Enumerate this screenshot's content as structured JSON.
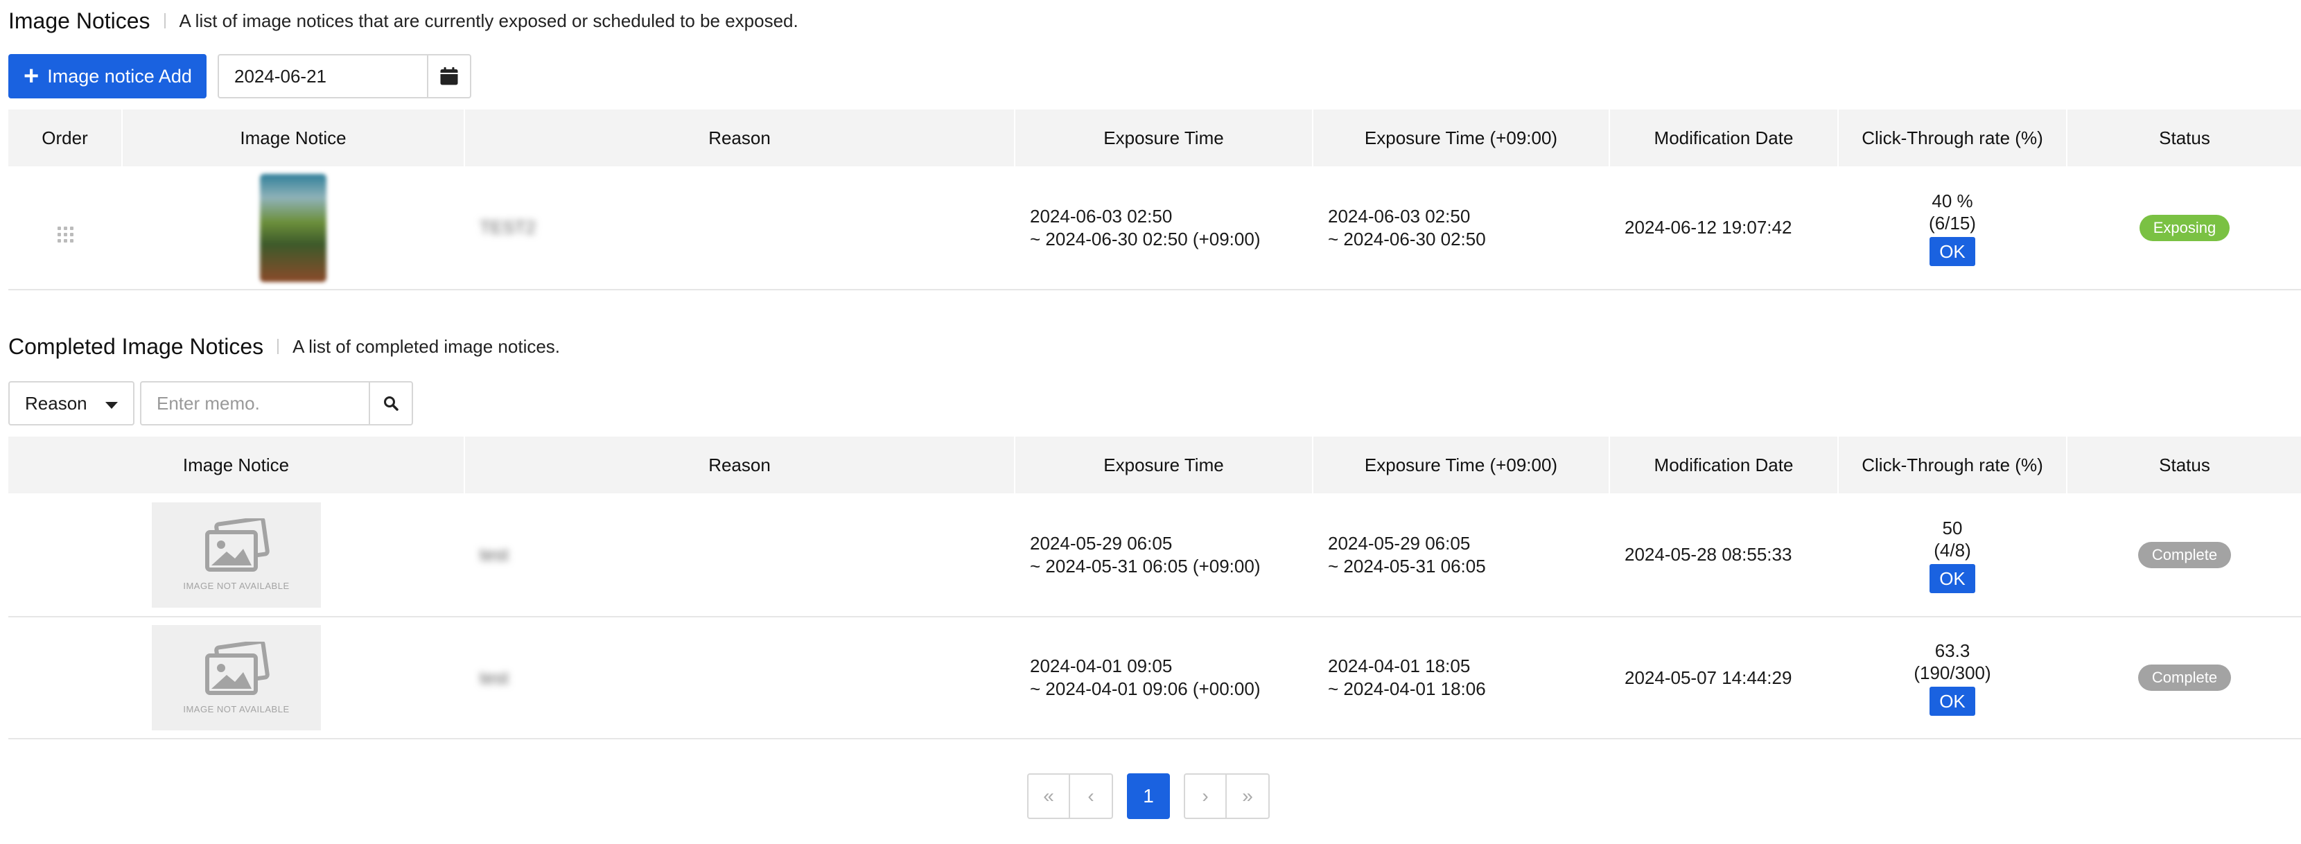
{
  "active_section": {
    "title": "Image Notices",
    "description": "A list of image notices that are currently exposed or scheduled to be exposed.",
    "add_button": "Image notice Add",
    "date_value": "2024-06-21",
    "headers": [
      "Order",
      "Image Notice",
      "Reason",
      "Exposure Time",
      "Exposure Time (+09:00)",
      "Modification Date",
      "Click-Through rate (%)",
      "Status"
    ],
    "rows": [
      {
        "reason": "TEST2",
        "exposure_start": "2024-06-03 02:50",
        "exposure_end": "~ 2024-06-30 02:50 (+09:00)",
        "kst_start": "2024-06-03 02:50",
        "kst_end": "~ 2024-06-30 02:50",
        "modified": "2024-06-12 19:07:42",
        "ctr_rate": "40 %",
        "ctr_count": "(6/15)",
        "ok_label": "OK",
        "status": "Exposing"
      }
    ]
  },
  "completed_section": {
    "title": "Completed Image Notices",
    "description": "A list of completed image notices.",
    "filter_select": "Reason",
    "search_placeholder": "Enter memo.",
    "headers": [
      "Image Notice",
      "Reason",
      "Exposure Time",
      "Exposure Time (+09:00)",
      "Modification Date",
      "Click-Through rate (%)",
      "Status"
    ],
    "image_not_available": "IMAGE NOT AVAILABLE",
    "rows": [
      {
        "reason": "test",
        "exposure_start": "2024-05-29 06:05",
        "exposure_end": "~ 2024-05-31 06:05 (+09:00)",
        "kst_start": "2024-05-29 06:05",
        "kst_end": "~ 2024-05-31 06:05",
        "modified": "2024-05-28 08:55:33",
        "ctr_rate": "50",
        "ctr_count": "(4/8)",
        "ok_label": "OK",
        "status": "Complete"
      },
      {
        "reason": "test",
        "exposure_start": "2024-04-01 09:05",
        "exposure_end": "~ 2024-04-01 09:06 (+00:00)",
        "kst_start": "2024-04-01 18:05",
        "kst_end": "~ 2024-04-01 18:06",
        "modified": "2024-05-07 14:44:29",
        "ctr_rate": "63.3",
        "ctr_count": "(190/300)",
        "ok_label": "OK",
        "status": "Complete"
      }
    ]
  },
  "pagination": {
    "current_page": "1"
  },
  "colors": {
    "primary": "#1a62e0",
    "exposing": "#7ac143",
    "complete": "#a3a3a3"
  },
  "icons": [
    "plus-icon",
    "calendar-icon",
    "drag-handle-icon",
    "search-icon",
    "chevron-down-icon",
    "image-placeholder-icon",
    "first-page-icon",
    "prev-page-icon",
    "next-page-icon",
    "last-page-icon"
  ]
}
